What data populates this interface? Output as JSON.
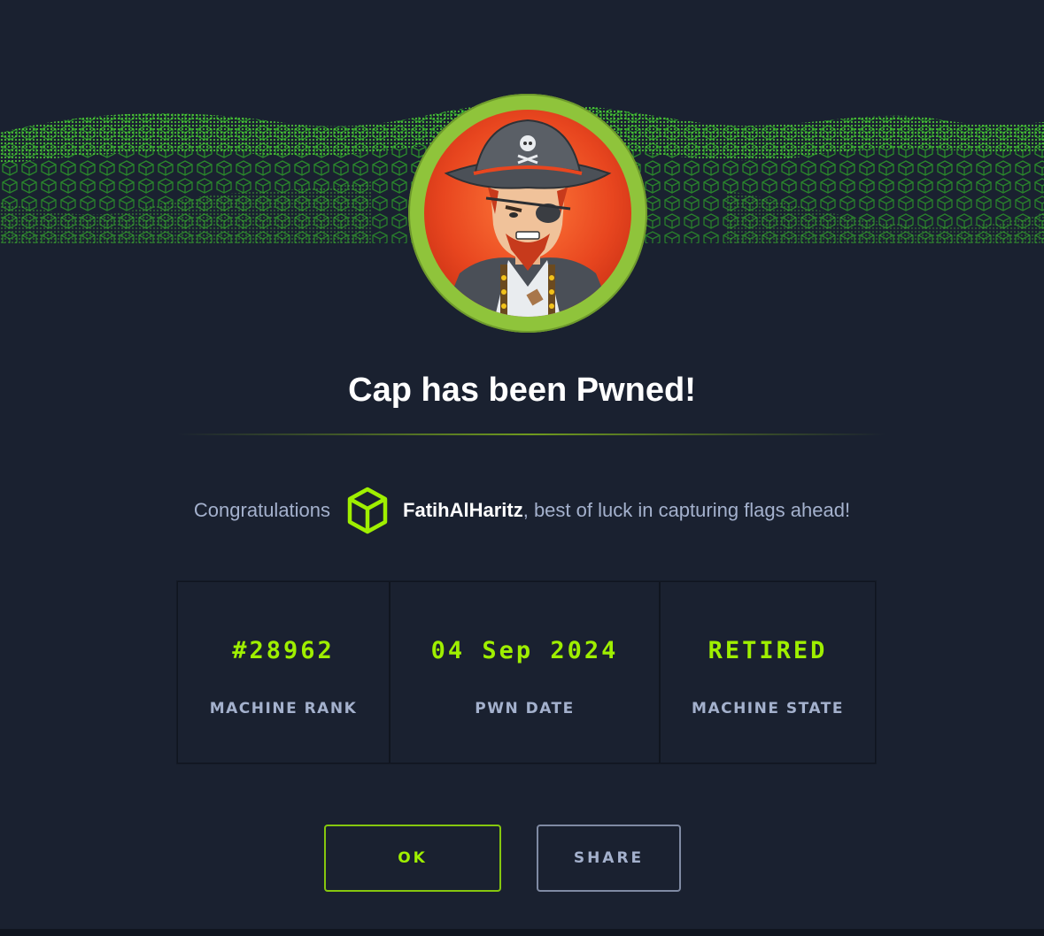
{
  "dialog": {
    "title": "Cap has been Pwned!",
    "congrats_prefix": "Congratulations",
    "username": "FatihAlHaritz",
    "congrats_suffix": ", best of luck in capturing flags ahead!"
  },
  "stats": [
    {
      "value": "#28962",
      "label": "MACHINE RANK"
    },
    {
      "value": "04 Sep 2024",
      "label": "PWN DATE"
    },
    {
      "value": "RETIRED",
      "label": "MACHINE STATE"
    }
  ],
  "buttons": {
    "ok": "OK",
    "share": "SHARE"
  },
  "colors": {
    "background": "#1a2130",
    "accent_green": "#9fef00",
    "muted_text": "#a4b1cd",
    "avatar_ring": "#8fc43b"
  },
  "icons": {
    "banner": "green-cube-wave-banner",
    "avatar": "pirate-captain-avatar",
    "user_rank": "cube-icon"
  }
}
